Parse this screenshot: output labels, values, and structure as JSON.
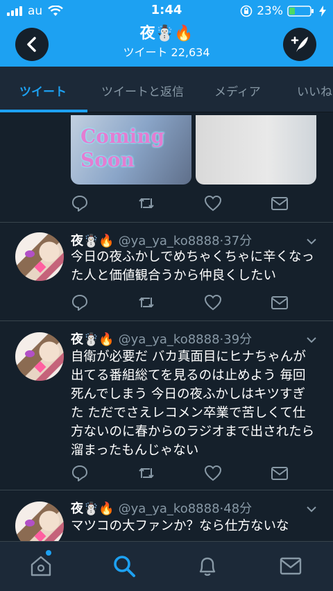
{
  "status_bar": {
    "carrier": "au",
    "time": "1:44",
    "battery": "23%"
  },
  "header": {
    "title": "夜☃️🔥",
    "subtitle": "ツイート 22,634",
    "back_icon": "chevron-left-icon",
    "compose_icon": "compose-tweet-icon"
  },
  "tabs": [
    {
      "label": "ツイート",
      "active": true
    },
    {
      "label": "ツイートと返信",
      "active": false
    },
    {
      "label": "メディア",
      "active": false
    },
    {
      "label": "いいね",
      "active": false
    }
  ],
  "first_tweet_media": {
    "overlay_text_line1": "Coming",
    "overlay_text_line2": "Soon"
  },
  "tweets": [
    {
      "name": "夜☃️🔥",
      "handle": "@ya_ya_ko8888",
      "time": "·37分",
      "text": "今日の夜ふかしでめちゃくちゃに辛くなった人と価値観合うから仲良くしたい"
    },
    {
      "name": "夜☃️🔥",
      "handle": "@ya_ya_ko8888",
      "time": "·39分",
      "text": "自衛が必要だ バカ真面目にヒナちゃんが出てる番組総てを見るのは止めよう 毎回死んでしまう 今日の夜ふかしはキツすぎた ただでさえレコメン卒業で苦しくて仕方ないのに春からのラジオまで出されたら溜まったもんじゃない"
    },
    {
      "name": "夜☃️🔥",
      "handle": "@ya_ya_ko8888",
      "time": "·48分",
      "text": "マツコの大ファンか？なら仕方ないな"
    }
  ],
  "colors": {
    "accent": "#1da1f2",
    "background": "#15202b",
    "panel": "#1c2938",
    "muted": "#8899a6"
  }
}
